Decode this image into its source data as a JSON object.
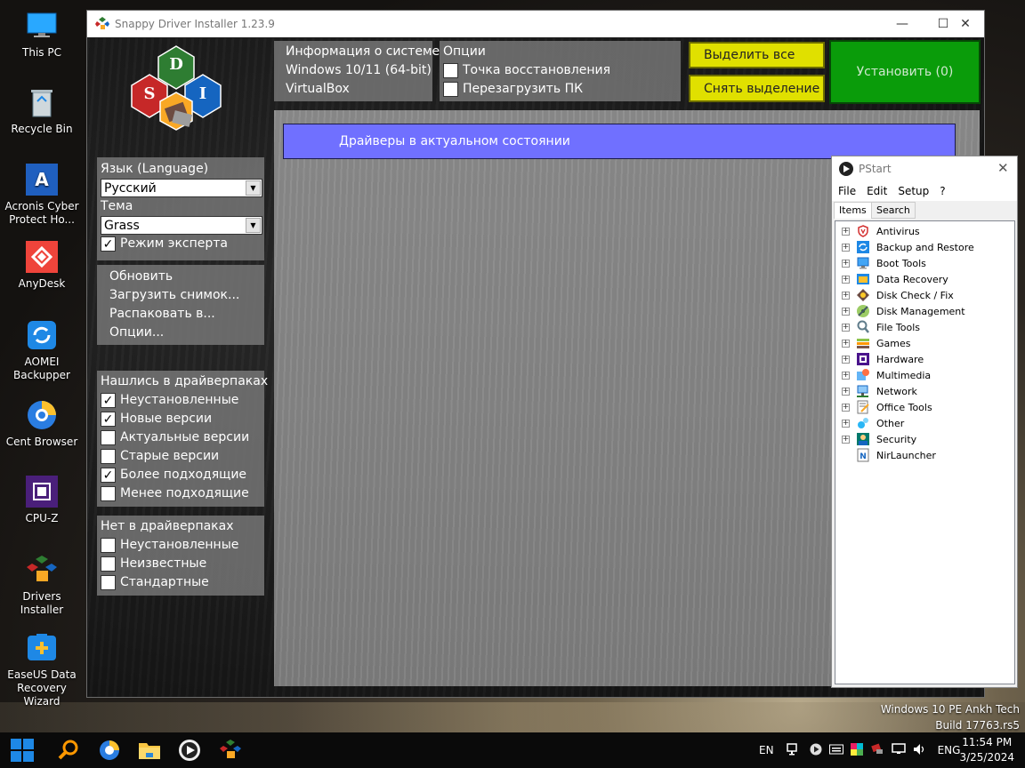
{
  "desktop": {
    "icons": [
      {
        "label": "This PC",
        "icon": "monitor-icon",
        "color": "#1e90ff"
      },
      {
        "label": "Recycle Bin",
        "icon": "recycle-bin-icon",
        "color": "#b0c4de"
      },
      {
        "label": "Acronis Cyber Protect Ho...",
        "icon": "acronis-icon",
        "color": "#1f5fbf"
      },
      {
        "label": "AnyDesk",
        "icon": "anydesk-icon",
        "color": "#ef443b"
      },
      {
        "label": "AOMEI Backupper",
        "icon": "aomei-icon",
        "color": "#1e88e5"
      },
      {
        "label": "Cent Browser",
        "icon": "cent-browser-icon",
        "color": "#2a7de1"
      },
      {
        "label": "CPU-Z",
        "icon": "cpuz-icon",
        "color": "#5b2c8f"
      },
      {
        "label": "Drivers Installer",
        "icon": "sdi-icon",
        "color": "#2e7d32"
      },
      {
        "label": "EaseUS Data Recovery Wizard",
        "icon": "easeus-icon",
        "color": "#1e88e5"
      }
    ]
  },
  "sdi": {
    "title": "Snappy Driver Installer 1.23.9",
    "logo_letters": [
      "D",
      "S",
      "I"
    ],
    "sysinfo": {
      "heading": "Информация о системе",
      "os": "Windows 10/11 (64-bit)",
      "machine": "VirtualBox"
    },
    "options": {
      "heading": "Опции",
      "restore_point": "Точка восстановления",
      "restart_pc": "Перезагрузить ПК"
    },
    "buttons": {
      "select_all": "Выделить все",
      "deselect": "Снять выделение",
      "install": "Установить (0)"
    },
    "language": {
      "label": "Язык (Language)",
      "value": "Русский"
    },
    "theme": {
      "label": "Тема",
      "value": "Grass"
    },
    "expert_mode": "Режим эксперта",
    "actions": [
      "Обновить",
      "Загрузить снимок...",
      "Распаковать в...",
      "Опции..."
    ],
    "found": {
      "heading": "Нашлись в драйверпаках",
      "items": [
        {
          "label": "Неустановленные",
          "checked": true
        },
        {
          "label": "Новые версии",
          "checked": true
        },
        {
          "label": "Актуальные версии",
          "checked": false
        },
        {
          "label": "Старые версии",
          "checked": false
        },
        {
          "label": "Более подходящие",
          "checked": true
        },
        {
          "label": "Менее подходящие",
          "checked": false
        }
      ]
    },
    "not_found": {
      "heading": "Нет в драйверпаках",
      "items": [
        {
          "label": "Неустановленные",
          "checked": false
        },
        {
          "label": "Неизвестные",
          "checked": false
        },
        {
          "label": "Стандартные",
          "checked": false
        }
      ]
    },
    "status": "Драйверы в актуальном состоянии"
  },
  "pstart": {
    "title": "PStart",
    "menu": [
      "File",
      "Edit",
      "Setup",
      "?"
    ],
    "tabs": [
      "Items",
      "Search"
    ],
    "items": [
      {
        "label": "Antivirus",
        "icon": "antivirus-icon",
        "expandable": true
      },
      {
        "label": "Backup and Restore",
        "icon": "backup-icon",
        "expandable": true
      },
      {
        "label": "Boot Tools",
        "icon": "boot-tools-icon",
        "expandable": true
      },
      {
        "label": "Data Recovery",
        "icon": "data-recovery-icon",
        "expandable": true
      },
      {
        "label": "Disk Check / Fix",
        "icon": "disk-check-icon",
        "expandable": true
      },
      {
        "label": "Disk Management",
        "icon": "disk-management-icon",
        "expandable": true
      },
      {
        "label": "File Tools",
        "icon": "file-tools-icon",
        "expandable": true
      },
      {
        "label": "Games",
        "icon": "games-icon",
        "expandable": true
      },
      {
        "label": "Hardware",
        "icon": "hardware-icon",
        "expandable": true
      },
      {
        "label": "Multimedia",
        "icon": "multimedia-icon",
        "expandable": true
      },
      {
        "label": "Network",
        "icon": "network-icon",
        "expandable": true
      },
      {
        "label": "Office Tools",
        "icon": "office-tools-icon",
        "expandable": true
      },
      {
        "label": "Other",
        "icon": "other-icon",
        "expandable": true
      },
      {
        "label": "Security",
        "icon": "security-icon",
        "expandable": true
      },
      {
        "label": "NirLauncher",
        "icon": "nirlauncher-icon",
        "expandable": false
      }
    ]
  },
  "watermark": {
    "line1": "Windows 10 PE Ankh Tech",
    "line2": "Build 17763.rs5"
  },
  "taskbar": {
    "lang_left": "EN",
    "lang_right": "ENG",
    "time": "11:54 PM",
    "date": "3/25/2024"
  }
}
